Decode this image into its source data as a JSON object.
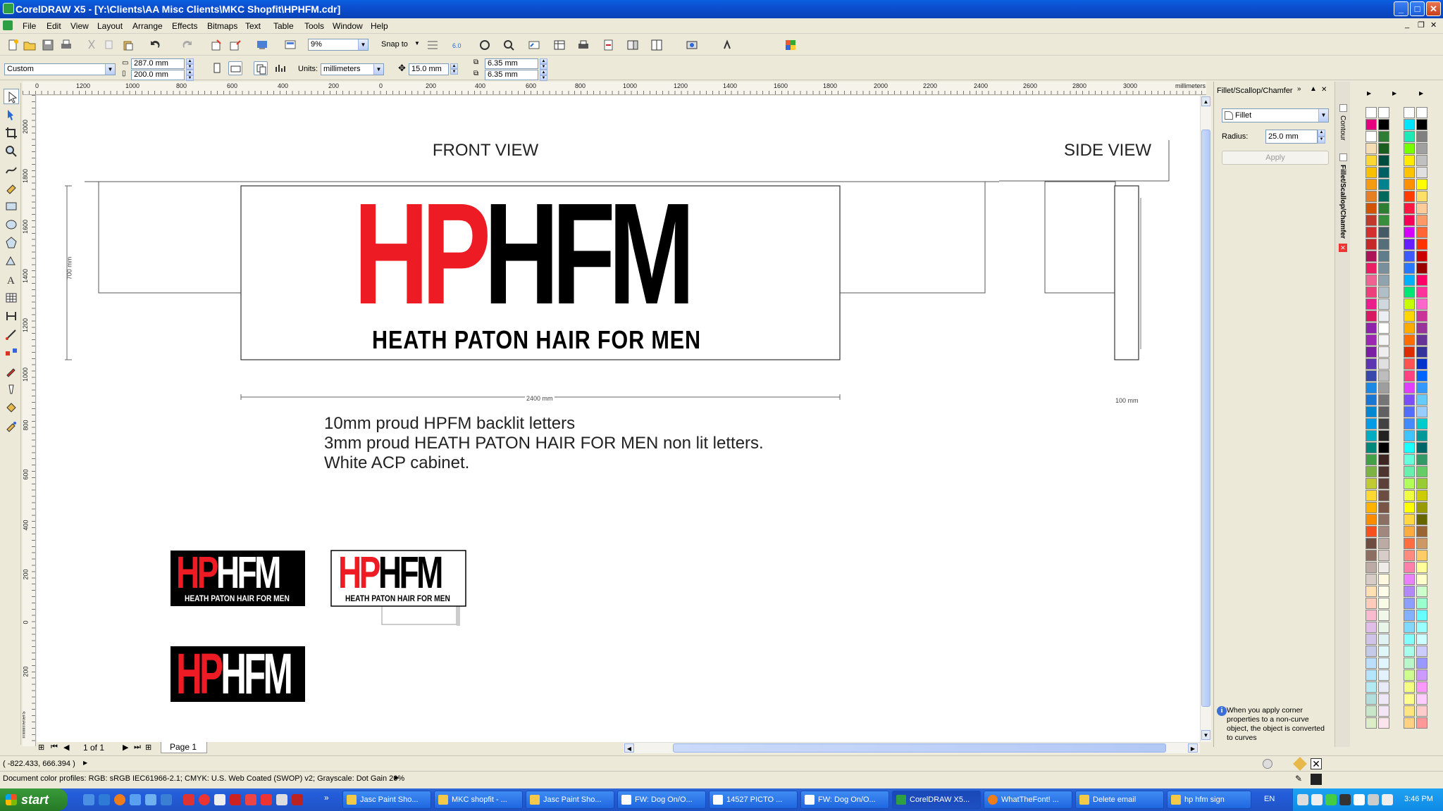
{
  "window": {
    "title": "CorelDRAW X5 - [Y:\\Clients\\AA Misc Clients\\MKC Shopfit\\HPHFM.cdr]",
    "minimize": "_",
    "maximize": "□",
    "close": "✕"
  },
  "menu": [
    "File",
    "Edit",
    "View",
    "Layout",
    "Arrange",
    "Effects",
    "Bitmaps",
    "Text",
    "Table",
    "Tools",
    "Window",
    "Help"
  ],
  "toolbar1": {
    "zoom": "9%",
    "snap_to": "Snap to"
  },
  "property_bar": {
    "paper_type": "Custom",
    "width": "287.0 mm",
    "height": "200.0 mm",
    "units_label": "Units:",
    "units": "millimeters",
    "nudge": "15.0 mm",
    "dup_x": "6.35 mm",
    "dup_y": "6.35 mm"
  },
  "ruler": {
    "unit": "millimeters",
    "h_labels": [
      "0",
      "1200",
      "1000",
      "800",
      "600",
      "400",
      "200",
      "0",
      "200",
      "400",
      "600",
      "800",
      "1000",
      "1200",
      "1400",
      "1600",
      "1800",
      "2000",
      "2200",
      "2400",
      "2600",
      "2800",
      "3000"
    ],
    "v_labels": [
      "2000",
      "1800",
      "1600",
      "1400",
      "1200",
      "1000",
      "800",
      "600",
      "400",
      "200",
      "0",
      "200"
    ],
    "v_unit": "millimeters"
  },
  "drawing": {
    "front_view_label": "FRONT VIEW",
    "side_view_label": "SIDE VIEW",
    "logo_red": "HP",
    "logo_black": "HFM",
    "logo_tagline": "HEATH PATON HAIR FOR MEN",
    "dim_height": "700 mm",
    "dim_width": "2400 mm",
    "dim_depth": "100 mm",
    "notes": [
      "10mm proud HPFM backlit letters",
      "3mm proud HEATH PATON HAIR FOR MEN non lit letters.",
      "White ACP cabinet."
    ],
    "colors": {
      "red": "#ed1c24",
      "black": "#000000"
    }
  },
  "page_nav": {
    "count": "1 of 1",
    "tab": "Page 1"
  },
  "docker": {
    "title": "Fillet/Scallop/Chamfer",
    "operation": "Fillet",
    "radius_label": "Radius:",
    "radius": "25.0 mm",
    "apply": "Apply",
    "info": "When you apply corner properties to a non-curve object, the object is converted to curves",
    "tabs": [
      "Contour",
      "Fillet/Scallop/Chamfer"
    ]
  },
  "status": {
    "coords": "( -822.433, 666.394 )",
    "color_profiles": "Document color profiles: RGB: sRGB IEC61966-2.1; CMYK: U.S. Web Coated (SWOP) v2; Grayscale: Dot Gain 20%"
  },
  "palette_colors": {
    "col1": [
      "#ffffff",
      "#e6007e",
      "#ffffff",
      "#f5deb3",
      "#fdd835",
      "#f9c000",
      "#f39c12",
      "#e67e22",
      "#d35400",
      "#c0392b",
      "#d32f2f",
      "#c62828",
      "#ad1457",
      "#e91e63",
      "#f06292",
      "#ec407a",
      "#e91e8c",
      "#d81b60",
      "#8e24aa",
      "#9c27b0",
      "#7b1fa2",
      "#5e35b1",
      "#3949ab",
      "#1e88e5",
      "#1976d2",
      "#0288d1",
      "#039be5",
      "#00acc1",
      "#00897b",
      "#43a047",
      "#7cb342",
      "#c0ca33",
      "#fdd835",
      "#ffb300",
      "#fb8c00",
      "#f4511e",
      "#6d4c41",
      "#8d6e63",
      "#bcaaa4",
      "#d7ccc8",
      "#ffe0b2",
      "#ffccbc",
      "#f8bbd0",
      "#e1bee7",
      "#d1c4e9",
      "#c5cae9",
      "#bbdefb",
      "#b3e5fc",
      "#b2ebf2",
      "#b2dfdb",
      "#c8e6c9",
      "#dcedc8"
    ],
    "col2": [
      "#ffffff",
      "#000000",
      "#2e7d32",
      "#1b5e20",
      "#004d40",
      "#006064",
      "#00838f",
      "#00695c",
      "#2e7d32",
      "#388e3c",
      "#455a64",
      "#546e7a",
      "#607d8b",
      "#78909c",
      "#90a4ae",
      "#b0bec5",
      "#cfd8dc",
      "#eceff1",
      "#ffffff",
      "#f5f5f5",
      "#eeeeee",
      "#e0e0e0",
      "#bdbdbd",
      "#9e9e9e",
      "#757575",
      "#616161",
      "#424242",
      "#212121",
      "#000000",
      "#3e2723",
      "#4e342e",
      "#5d4037",
      "#6d4c41",
      "#795548",
      "#8d6e63",
      "#a1887f",
      "#bcaaa4",
      "#d7ccc8",
      "#efebe9",
      "#fff8e1",
      "#fffde7",
      "#f9fbe7",
      "#f1f8e9",
      "#e8f5e9",
      "#e0f2f1",
      "#e0f7fa",
      "#e1f5fe",
      "#e3f2fd",
      "#e8eaf6",
      "#ede7f6",
      "#f3e5f5",
      "#fce4ec"
    ],
    "col3": [
      "#ffffff",
      "#00e5ff",
      "#1de9b6",
      "#76ff03",
      "#ffea00",
      "#ffc400",
      "#ff9100",
      "#ff3d00",
      "#ff1744",
      "#f50057",
      "#d500f9",
      "#651fff",
      "#3d5afe",
      "#2979ff",
      "#00b0ff",
      "#00e676",
      "#c6ff00",
      "#ffd600",
      "#ffab00",
      "#ff6d00",
      "#dd2c00",
      "#ff5252",
      "#ff4081",
      "#e040fb",
      "#7c4dff",
      "#536dfe",
      "#448aff",
      "#40c4ff",
      "#18ffff",
      "#64ffda",
      "#69f0ae",
      "#b2ff59",
      "#eeff41",
      "#ffff00",
      "#ffd740",
      "#ffab40",
      "#ff6e40",
      "#ff8a80",
      "#ff80ab",
      "#ea80fc",
      "#b388ff",
      "#8c9eff",
      "#82b1ff",
      "#80d8ff",
      "#84ffff",
      "#a7ffeb",
      "#b9f6ca",
      "#ccff90",
      "#f4ff81",
      "#ffff8d",
      "#ffe57f",
      "#ffd180"
    ],
    "col4": [
      "#ffffff",
      "#000000",
      "#808080",
      "#a0a0a0",
      "#c0c0c0",
      "#e0e0e0",
      "#ffff00",
      "#ffe066",
      "#ffcc99",
      "#ff9966",
      "#ff6633",
      "#ff3300",
      "#cc0000",
      "#990000",
      "#ff0066",
      "#ff3399",
      "#ff66cc",
      "#cc3399",
      "#993399",
      "#663399",
      "#333399",
      "#0033cc",
      "#0066ff",
      "#3399ff",
      "#66ccff",
      "#99ccff",
      "#00cccc",
      "#009999",
      "#006666",
      "#339966",
      "#66cc66",
      "#99cc33",
      "#cccc00",
      "#999900",
      "#666600",
      "#996633",
      "#cc9966",
      "#ffcc66",
      "#ffff99",
      "#ffffcc",
      "#ccffcc",
      "#99ffcc",
      "#66ffff",
      "#99ffff",
      "#ccffff",
      "#ccccff",
      "#9999ff",
      "#cc99ff",
      "#ff99ff",
      "#ffccff",
      "#ffcccc",
      "#ff9999"
    ]
  },
  "taskbar": {
    "start": "start",
    "tasks": [
      "Jasc Paint Sho...",
      "MKC shopfit - ...",
      "Jasc Paint Sho...",
      "FW: Dog On/O...",
      "14527 PICTO ...",
      "FW: Dog On/O...",
      "CorelDRAW X5...",
      "WhatTheFont! ...",
      "Delete email",
      "hp hfm sign"
    ],
    "lang": "EN",
    "clock": "3:46 PM"
  }
}
